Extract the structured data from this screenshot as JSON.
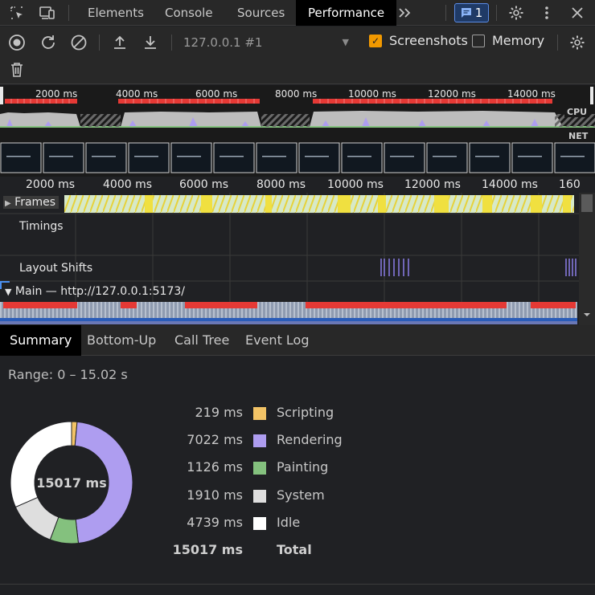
{
  "tabbar": {
    "tabs": [
      "Elements",
      "Console",
      "Sources",
      "Performance"
    ],
    "active_tab": "Performance",
    "issues_count": "1",
    "more_tabs_icon": "double-chevron-right-icon"
  },
  "toolbar": {
    "profile_label": "127.0.0.1 #1",
    "screenshots_label": "Screenshots",
    "screenshots_checked": true,
    "memory_label": "Memory",
    "memory_checked": false
  },
  "overview": {
    "ticks": [
      "2000 ms",
      "4000 ms",
      "6000 ms",
      "8000 ms",
      "10000 ms",
      "12000 ms",
      "14000 ms"
    ],
    "cpu_label": "CPU",
    "net_label": "NET"
  },
  "flame": {
    "ticks": [
      "2000 ms",
      "4000 ms",
      "6000 ms",
      "8000 ms",
      "10000 ms",
      "12000 ms",
      "14000 ms",
      "160"
    ],
    "tracks": {
      "frames": "Frames",
      "timings": "Timings",
      "layout_shifts": "Layout Shifts",
      "main": "Main — http://127.0.0.1:5173/"
    }
  },
  "bottom_tabs": [
    "Summary",
    "Bottom-Up",
    "Call Tree",
    "Event Log"
  ],
  "summary": {
    "range": "Range: 0 – 15.02 s",
    "center_label": "15017 ms",
    "rows": [
      {
        "ms": "219 ms",
        "name": "Scripting",
        "color": "#f2c366",
        "value": 219
      },
      {
        "ms": "7022 ms",
        "name": "Rendering",
        "color": "#ae9df0",
        "value": 7022
      },
      {
        "ms": "1126 ms",
        "name": "Painting",
        "color": "#84c17e",
        "value": 1126
      },
      {
        "ms": "1910 ms",
        "name": "System",
        "color": "#dedede",
        "value": 1910
      },
      {
        "ms": "4739 ms",
        "name": "Idle",
        "color": "#ffffff",
        "value": 4739
      }
    ],
    "total_ms": "15017 ms",
    "total_label": "Total"
  }
}
